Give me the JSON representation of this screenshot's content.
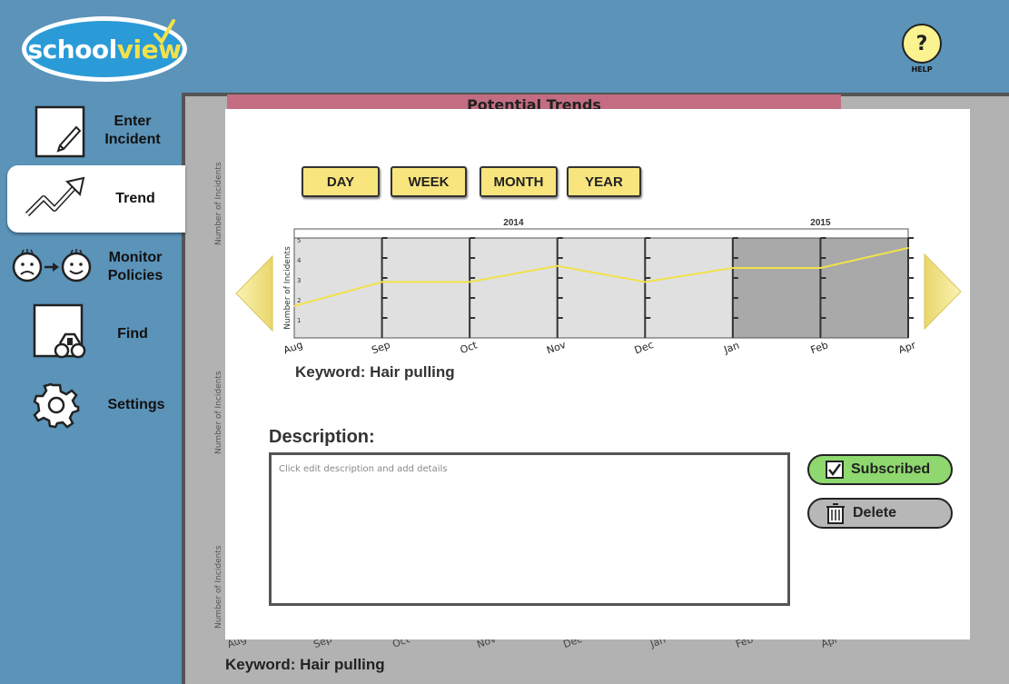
{
  "logo": {
    "school": "school",
    "view": "view"
  },
  "help": {
    "symbol": "?",
    "label": "HELP"
  },
  "sidebar": {
    "items": [
      {
        "label_line1": "Enter",
        "label_line2": "Incident"
      },
      {
        "label_line1": "Trend",
        "label_line2": ""
      },
      {
        "label_line1": "Monitor",
        "label_line2": "Policies"
      },
      {
        "label_line1": "Find",
        "label_line2": ""
      },
      {
        "label_line1": "Settings",
        "label_line2": ""
      }
    ]
  },
  "background_card": {
    "title": "Potential Trends",
    "axis_label": "Number of Incidents",
    "months": [
      "Aug",
      "Sep",
      "Oct",
      "Nov",
      "Dec",
      "Jan",
      "Feb",
      "Apr"
    ],
    "keyword": "Keyword: Hair pulling"
  },
  "range_buttons": {
    "day": "DAY",
    "week": "WEEK",
    "month": "MONTH",
    "year": "YEAR"
  },
  "chart_data": {
    "type": "line",
    "ylabel": "Number of Incidents",
    "xlabel": "",
    "ylim": [
      0,
      5
    ],
    "years": [
      {
        "label": "2014",
        "span": [
          "Aug",
          "Dec"
        ]
      },
      {
        "label": "2015",
        "span": [
          "Jan",
          "Apr"
        ]
      }
    ],
    "yticks": [
      "1",
      "2",
      "3",
      "4",
      "5"
    ],
    "categories": [
      "Aug",
      "Sep",
      "Oct",
      "Nov",
      "Dec",
      "Jan",
      "Feb",
      "Apr"
    ],
    "series": [
      {
        "values": [
          1.6,
          2.8,
          2.8,
          3.6,
          2.8,
          3.5,
          3.5,
          4.5
        ],
        "color": "#f2e14c"
      }
    ],
    "grid": true
  },
  "keyword": "Keyword: Hair pulling",
  "description": {
    "title": "Description:",
    "placeholder": "Click edit description and add details"
  },
  "actions": {
    "subscribed": "Subscribed",
    "delete": "Delete"
  },
  "colors": {
    "background": "#5b93b9",
    "accent_yellow": "#f8e57e",
    "subscribed_green": "#8fd86f",
    "title_bar_pink": "#c46d82"
  }
}
